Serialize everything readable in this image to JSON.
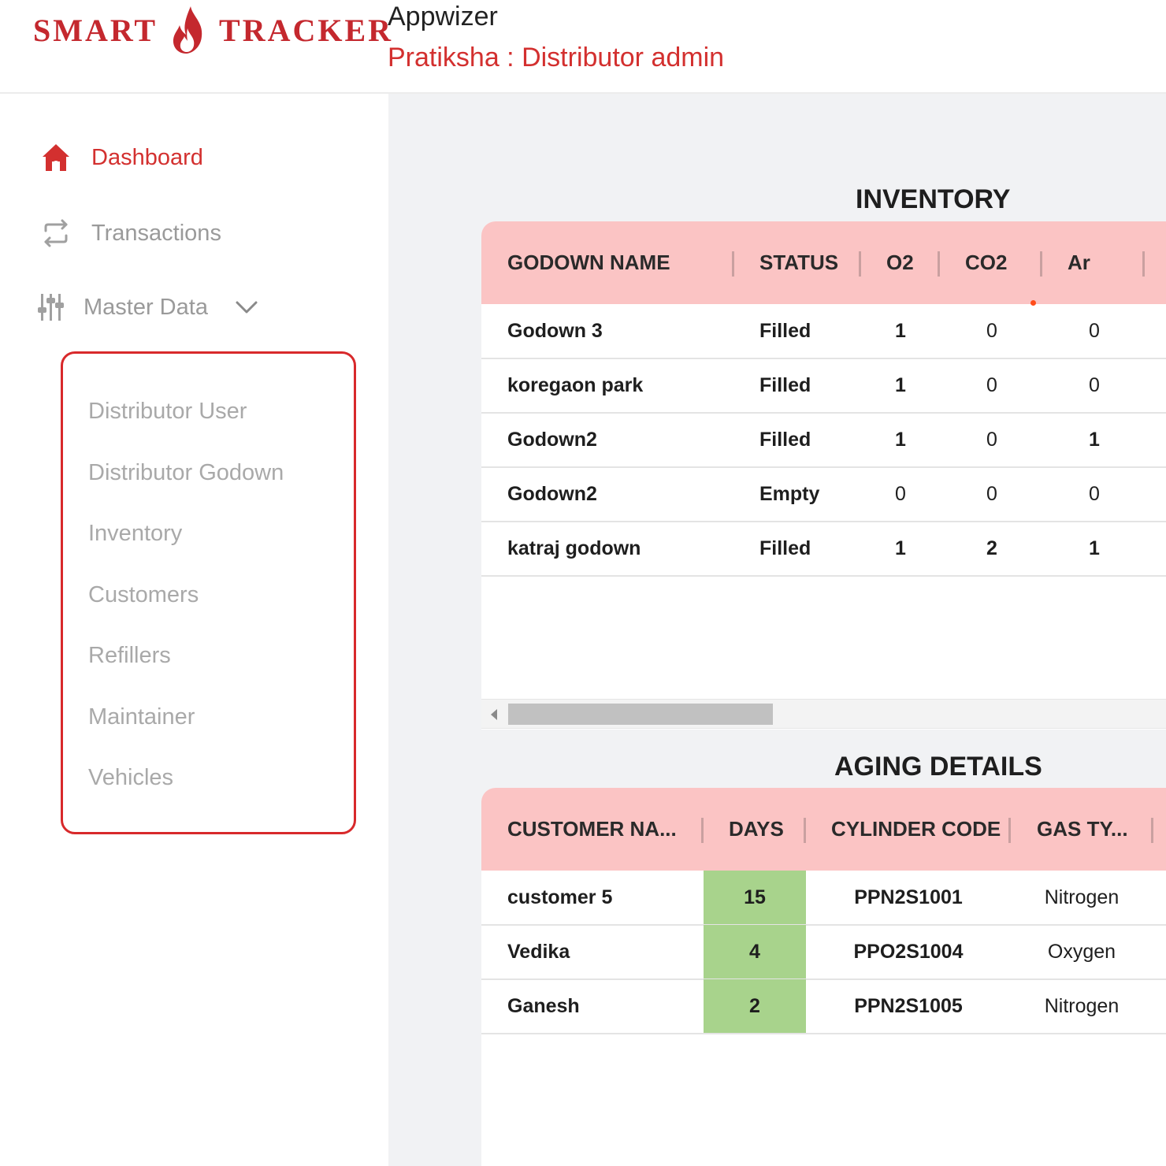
{
  "header": {
    "logo_left": "SMART",
    "logo_right": "TRACKER",
    "app_name": "Appwizer",
    "user_role": "Pratiksha : Distributor admin"
  },
  "sidebar": {
    "items": [
      {
        "label": "Dashboard",
        "icon": "home-icon",
        "active": true
      },
      {
        "label": "Transactions",
        "icon": "transactions-icon",
        "active": false
      },
      {
        "label": "Master Data",
        "icon": "sliders-icon",
        "active": false,
        "expanded": true
      }
    ],
    "submenu": [
      {
        "label": "Distributor User"
      },
      {
        "label": "Distributor Godown"
      },
      {
        "label": "Inventory"
      },
      {
        "label": "Customers"
      },
      {
        "label": "Refillers"
      },
      {
        "label": "Maintainer"
      },
      {
        "label": "Vehicles"
      }
    ]
  },
  "inventory": {
    "title": "INVENTORY",
    "columns": [
      "GODOWN NAME",
      "STATUS",
      "O2",
      "CO2",
      "Ar"
    ],
    "rows": [
      {
        "name": "Godown 3",
        "status": "Filled",
        "o2": "1",
        "co2": "0",
        "ar": "0"
      },
      {
        "name": "koregaon park",
        "status": "Filled",
        "o2": "1",
        "co2": "0",
        "ar": "0"
      },
      {
        "name": "Godown2",
        "status": "Filled",
        "o2": "1",
        "co2": "0",
        "ar": "1"
      },
      {
        "name": "Godown2",
        "status": "Empty",
        "o2": "0",
        "co2": "0",
        "ar": "0"
      },
      {
        "name": "katraj godown",
        "status": "Filled",
        "o2": "1",
        "co2": "2",
        "ar": "1"
      }
    ]
  },
  "aging": {
    "title": "AGING DETAILS",
    "columns": [
      "CUSTOMER NA...",
      "DAYS",
      "CYLINDER CODE",
      "GAS TY..."
    ],
    "rows": [
      {
        "customer": "customer 5",
        "days": "15",
        "cylinder": "PPN2S1001",
        "gas": "Nitrogen"
      },
      {
        "customer": "Vedika",
        "days": "4",
        "cylinder": "PPO2S1004",
        "gas": "Oxygen"
      },
      {
        "customer": "Ganesh",
        "days": "2",
        "cylinder": "PPN2S1005",
        "gas": "Nitrogen"
      }
    ]
  },
  "colors": {
    "brand_red": "#d3302f",
    "table_header": "#fbc4c4",
    "days_highlight": "#a8d38c",
    "main_bg": "#f1f2f4"
  }
}
